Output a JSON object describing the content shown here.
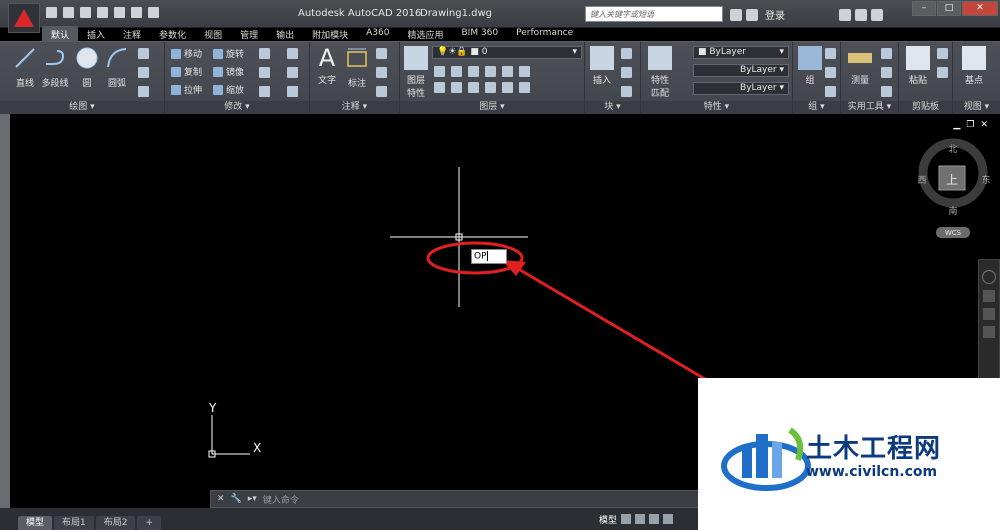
{
  "title": {
    "app": "Autodesk AutoCAD 2016",
    "doc": "Drawing1.dwg"
  },
  "search": {
    "placeholder": "键入关键字或短语"
  },
  "user": {
    "login": "登录"
  },
  "tabs": [
    "默认",
    "插入",
    "注释",
    "参数化",
    "视图",
    "管理",
    "输出",
    "附加模块",
    "A360",
    "精选应用",
    "BIM 360",
    "Performance"
  ],
  "ribbon": {
    "draw": {
      "title": "绘图 ▾",
      "line": "直线",
      "polyline": "多段线",
      "circle": "圆",
      "arc": "圆弧"
    },
    "modify": {
      "title": "修改 ▾",
      "move": "移动",
      "rotate": "旋转",
      "copy": "复制",
      "mirror": "镜像",
      "stretch": "拉伸",
      "scale": "缩放"
    },
    "annotate": {
      "title": "注释 ▾",
      "text": "文字",
      "dim": "标注"
    },
    "layers": {
      "title": "图层 ▾",
      "props": "图层\n特性",
      "current": "0"
    },
    "block": {
      "title": "块 ▾",
      "insert": "插入"
    },
    "properties": {
      "title": "特性 ▾",
      "match": "特性\n匹配",
      "color": "ByLayer",
      "linetype": "ByLayer",
      "lineweight": "ByLayer"
    },
    "groups": {
      "title": "组 ▾",
      "group": "组"
    },
    "utilities": {
      "title": "实用工具 ▾",
      "measure": "测量"
    },
    "clipboard": {
      "title": "剪贴板",
      "paste": "粘贴"
    },
    "view": {
      "title": "视图 ▾",
      "base": "基点"
    }
  },
  "viewcube": {
    "north": "北",
    "south": "南",
    "east": "东",
    "west": "西",
    "top": "上",
    "wcs": "WCS"
  },
  "ucs": {
    "x": "X",
    "y": "Y"
  },
  "input": {
    "value": "OP"
  },
  "cmd": {
    "placeholder": "键入命令"
  },
  "layout_tabs": [
    "模型",
    "布局1",
    "布局2",
    "+"
  ],
  "status": {
    "model": "模型"
  },
  "watermark": {
    "brand": "土木工程网",
    "url": "www.civilcn.com"
  },
  "colors": {
    "annotation": "#e02020",
    "bg": "#000000",
    "ribbon": "#45494f"
  }
}
